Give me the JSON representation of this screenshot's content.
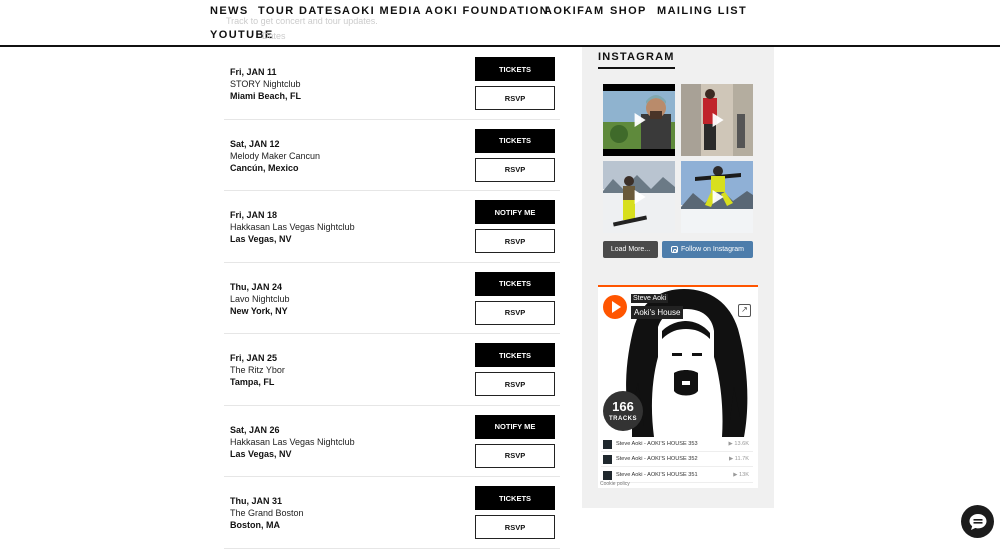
{
  "nav": {
    "items": [
      "NEWS",
      "TOUR DATES",
      "AOKI MEDIA",
      "AOKI FOUNDATION",
      "AOKIFAM",
      "SHOP",
      "MAILING LIST",
      "YOUTUBE"
    ]
  },
  "tour": {
    "track_text": "Track to get concert and tour updates.",
    "dates_text": "Dates"
  },
  "events": [
    {
      "date": "Fri, JAN 11",
      "venue": "STORY Nightclub",
      "city": "Miami Beach, FL",
      "primary": "TICKETS",
      "rsvp": "RSVP"
    },
    {
      "date": "Sat, JAN 12",
      "venue": "Melody Maker Cancun",
      "city": "Cancún, Mexico",
      "primary": "TICKETS",
      "rsvp": "RSVP"
    },
    {
      "date": "Fri, JAN 18",
      "venue": "Hakkasan Las Vegas Nightclub",
      "city": "Las Vegas, NV",
      "primary": "NOTIFY ME",
      "rsvp": "RSVP"
    },
    {
      "date": "Thu, JAN 24",
      "venue": "Lavo Nightclub",
      "city": "New York, NY",
      "primary": "TICKETS",
      "rsvp": "RSVP"
    },
    {
      "date": "Fri, JAN 25",
      "venue": "The Ritz Ybor",
      "city": "Tampa, FL",
      "primary": "TICKETS",
      "rsvp": "RSVP"
    },
    {
      "date": "Sat, JAN 26",
      "venue": "Hakkasan Las Vegas Nightclub",
      "city": "Las Vegas, NV",
      "primary": "NOTIFY ME",
      "rsvp": "RSVP"
    },
    {
      "date": "Thu, JAN 31",
      "venue": "The Grand Boston",
      "city": "Boston, MA",
      "primary": "TICKETS",
      "rsvp": "RSVP"
    }
  ],
  "instagram": {
    "title": "INSTAGRAM",
    "load_more": "Load More...",
    "follow": "Follow on Instagram"
  },
  "soundcloud": {
    "artist": "Steve Aoki",
    "track": "Aoki's House",
    "count": "166",
    "count_label": "TRACKS",
    "accent": "#ff5500",
    "rows": [
      {
        "title": "Steve Aoki - AOKI'S HOUSE 353",
        "plays": "13.6K"
      },
      {
        "title": "Steve Aoki - AOKI'S HOUSE 352",
        "plays": "11.7K"
      },
      {
        "title": "Steve Aoki - AOKI'S HOUSE 351",
        "plays": "13K"
      }
    ],
    "cookie": "Cookie policy"
  },
  "chat": {
    "icon": "chat-bubble-icon"
  }
}
